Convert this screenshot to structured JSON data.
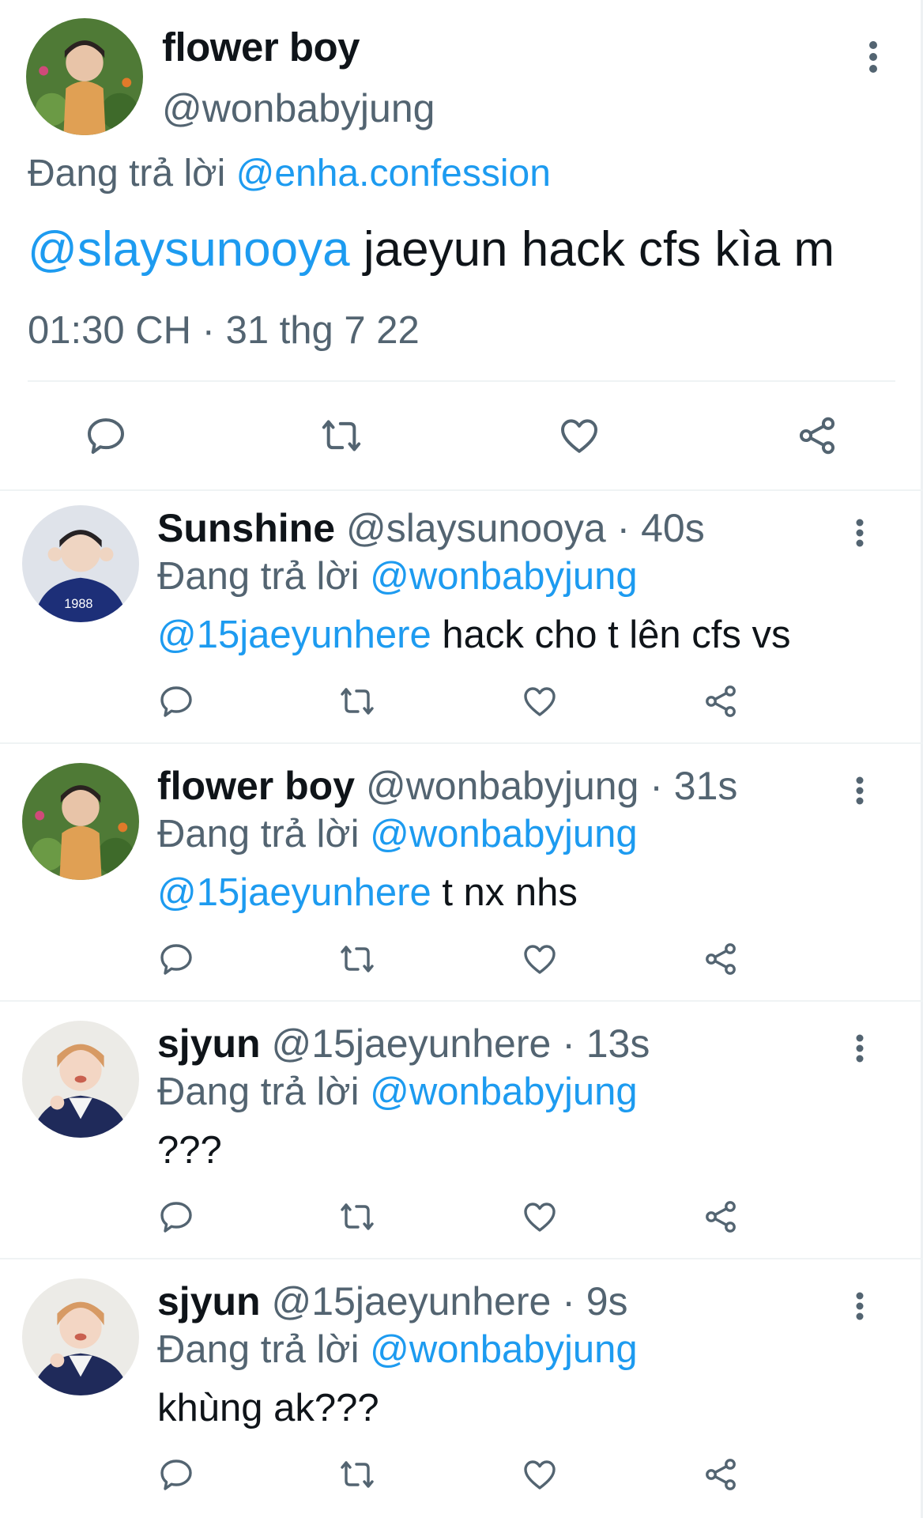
{
  "colors": {
    "link": "#1d9bf0",
    "secondary": "#536471",
    "text": "#0f1419"
  },
  "main_tweet": {
    "name": "flower boy",
    "handle": "@wonbabyjung",
    "reply_prefix": "Đang trả lời",
    "reply_to": "@enha.confession",
    "mention": "@slaysunooya",
    "text": " jaeyun hack cfs kìa m",
    "time": "01:30 CH",
    "separator": " · ",
    "date": "31 thg 7 22",
    "actions": [
      "comment-icon",
      "retweet-icon",
      "like-icon",
      "share-icon"
    ]
  },
  "replies": [
    {
      "name": "Sunshine",
      "handle": "@slaysunooya",
      "age": " · 40s",
      "reply_prefix": "Đang trả lời",
      "reply_to": "@wonbabyjung",
      "mention": "@15jaeyunhere",
      "text": " hack cho t lên cfs vs"
    },
    {
      "name": "flower boy",
      "handle": "@wonbabyjung",
      "age": " · 31s",
      "reply_prefix": "Đang trả lời",
      "reply_to": "@wonbabyjung",
      "mention": "@15jaeyunhere",
      "text": " t nx nhs"
    },
    {
      "name": "sjyun",
      "handle": "@15jaeyunhere",
      "age": " · 13s",
      "reply_prefix": "Đang trả lời",
      "reply_to": "@wonbabyjung",
      "mention": "",
      "text": "???"
    },
    {
      "name": "sjyun",
      "handle": "@15jaeyunhere",
      "age": " · 9s",
      "reply_prefix": "Đang trả lời",
      "reply_to": "@wonbabyjung",
      "mention": "",
      "text": "khùng ak???"
    }
  ]
}
